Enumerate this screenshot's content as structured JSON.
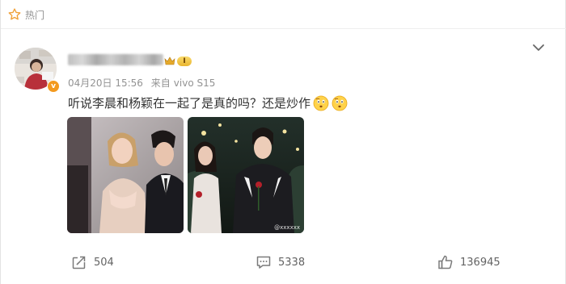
{
  "header": {
    "tag_icon": "star-outline-icon",
    "tag_label": "热门"
  },
  "post": {
    "author": {
      "name_obscured": true,
      "avatar": "avatar-image",
      "verified_icon": "verified-v-icon",
      "badges": [
        "crown-icon",
        "level-badge"
      ],
      "level_label": "I"
    },
    "meta": {
      "date": "04月20日 15:56",
      "source_prefix": "来自",
      "source": "vivo S15"
    },
    "text": "听说李晨和杨颖在一起了是真的吗？还是炒作",
    "emojis": [
      "thinking-face-emoji",
      "thinking-face-emoji"
    ],
    "images": [
      {
        "alt": "photo-1"
      },
      {
        "alt": "photo-2",
        "watermark": "@xxxxxx"
      }
    ],
    "actions": {
      "repost": {
        "icon": "repost-icon",
        "count": "504"
      },
      "comment": {
        "icon": "comment-icon",
        "count": "5338"
      },
      "like": {
        "icon": "thumbs-up-icon",
        "count": "136945"
      }
    }
  },
  "menu": {
    "icon": "chevron-down-icon"
  },
  "colors": {
    "meta_gray": "#939393",
    "text": "#333333",
    "badge_orange": "#f39a1f"
  }
}
